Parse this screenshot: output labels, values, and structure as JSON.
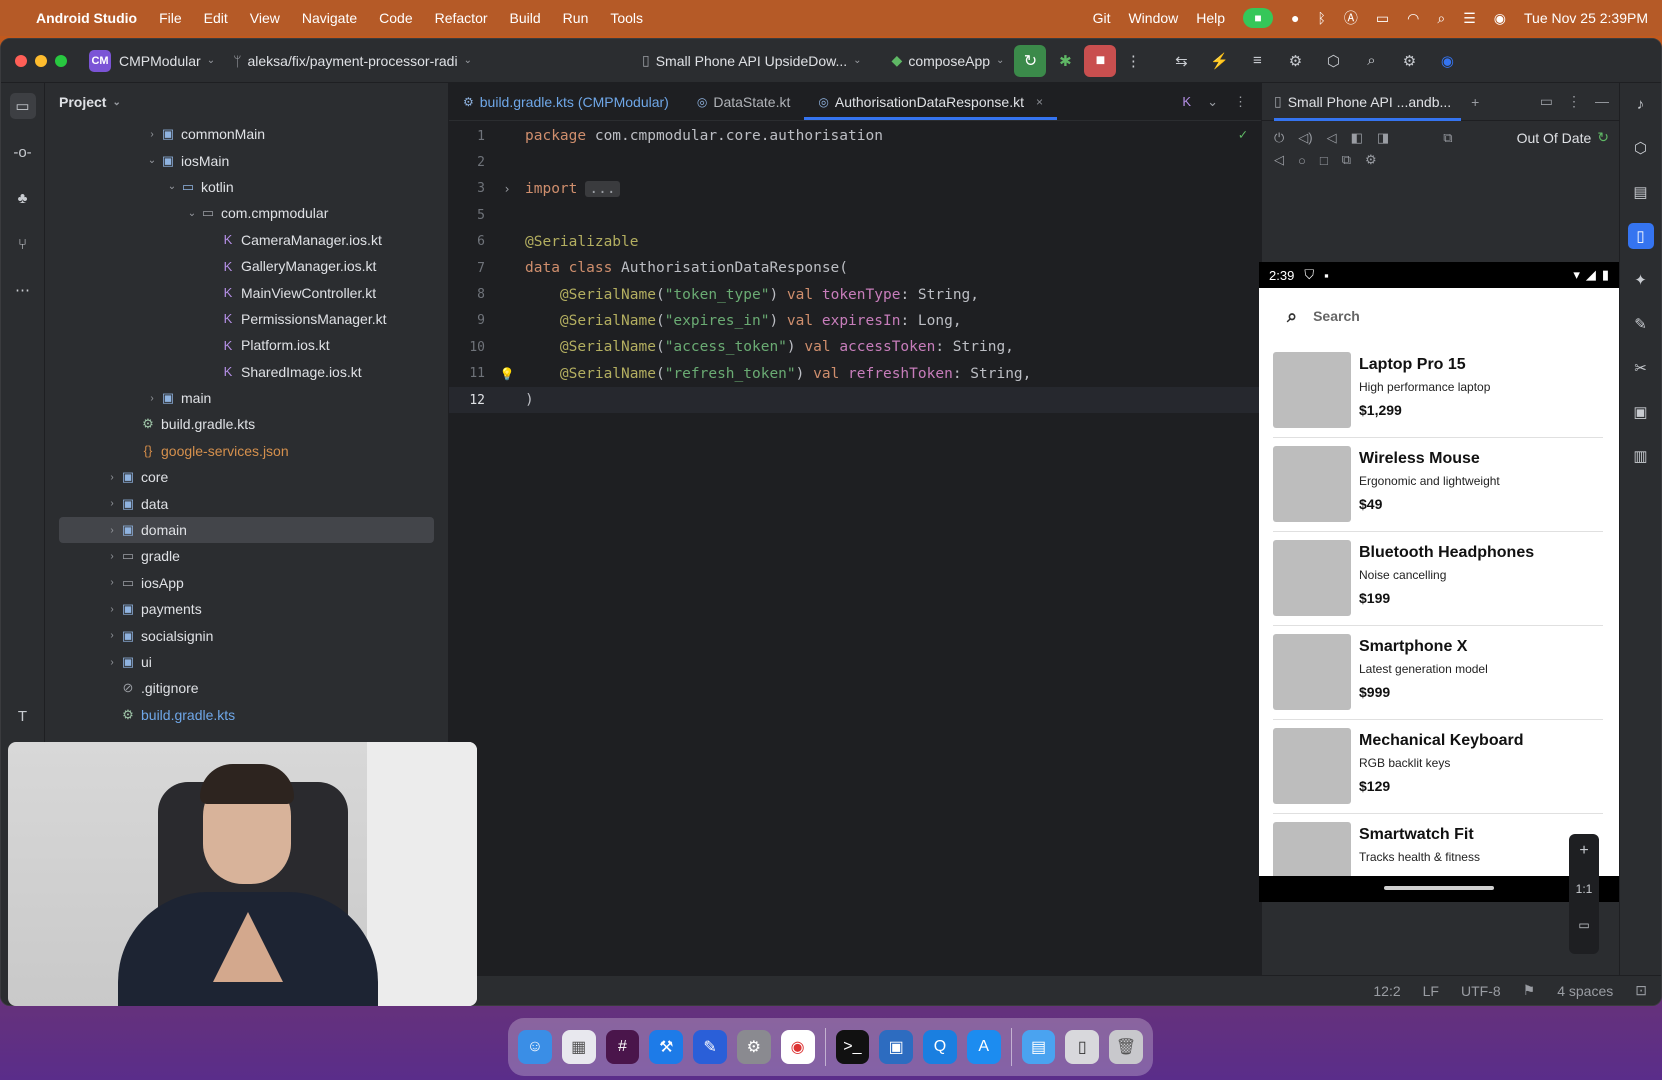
{
  "menubar": {
    "app_name": "Android Studio",
    "items": [
      "File",
      "Edit",
      "View",
      "Navigate",
      "Code",
      "Refactor",
      "Build",
      "Run",
      "Tools"
    ],
    "right_items": [
      "Git",
      "Window",
      "Help"
    ],
    "clock": "Tue Nov 25  2:39PM"
  },
  "titlebar": {
    "project_badge": "CM",
    "project_name": "CMPModular",
    "branch": "aleksa/fix/payment-processor-radi",
    "device": "Small Phone API UpsideDow...",
    "run_config": "composeApp"
  },
  "project_panel": {
    "title": "Project",
    "rows": [
      {
        "indent": 5,
        "arrow": ">",
        "icon": "folder-module-icon",
        "glyph": "▣",
        "cls": "",
        "label": "commonMain",
        "style": ""
      },
      {
        "indent": 5,
        "arrow": "v",
        "icon": "folder-module-icon",
        "glyph": "▣",
        "cls": "",
        "label": "iosMain",
        "style": ""
      },
      {
        "indent": 6,
        "arrow": "v",
        "icon": "folder-source-icon",
        "glyph": "▭",
        "cls": "",
        "label": "kotlin",
        "style": ""
      },
      {
        "indent": 7,
        "arrow": "v",
        "icon": "package-icon",
        "glyph": "▭",
        "cls": "gi",
        "label": "com.cmpmodular",
        "style": ""
      },
      {
        "indent": 8,
        "arrow": "",
        "icon": "kotlin-file-icon",
        "glyph": "K",
        "cls": "kt",
        "label": "CameraManager.ios.kt",
        "style": ""
      },
      {
        "indent": 8,
        "arrow": "",
        "icon": "kotlin-file-icon",
        "glyph": "K",
        "cls": "kt",
        "label": "GalleryManager.ios.kt",
        "style": ""
      },
      {
        "indent": 8,
        "arrow": "",
        "icon": "kotlin-file-icon",
        "glyph": "K",
        "cls": "kt",
        "label": "MainViewController.kt",
        "style": ""
      },
      {
        "indent": 8,
        "arrow": "",
        "icon": "kotlin-file-icon",
        "glyph": "K",
        "cls": "kt",
        "label": "PermissionsManager.kt",
        "style": ""
      },
      {
        "indent": 8,
        "arrow": "",
        "icon": "kotlin-file-icon",
        "glyph": "K",
        "cls": "kt",
        "label": "Platform.ios.kt",
        "style": ""
      },
      {
        "indent": 8,
        "arrow": "",
        "icon": "kotlin-file-icon",
        "glyph": "K",
        "cls": "kt",
        "label": "SharedImage.ios.kt",
        "style": ""
      },
      {
        "indent": 5,
        "arrow": ">",
        "icon": "folder-module-icon",
        "glyph": "▣",
        "cls": "",
        "label": "main",
        "style": ""
      },
      {
        "indent": 4,
        "arrow": "",
        "icon": "gradle-file-icon",
        "glyph": "⚙",
        "cls": "gr",
        "label": "build.gradle.kts",
        "style": ""
      },
      {
        "indent": 4,
        "arrow": "",
        "icon": "json-file-icon",
        "glyph": "{}",
        "cls": "js",
        "label": "google-services.json",
        "style": "orange"
      },
      {
        "indent": 3,
        "arrow": ">",
        "icon": "folder-module-icon",
        "glyph": "▣",
        "cls": "",
        "label": "core",
        "style": ""
      },
      {
        "indent": 3,
        "arrow": ">",
        "icon": "folder-module-icon",
        "glyph": "▣",
        "cls": "",
        "label": "data",
        "style": ""
      },
      {
        "indent": 3,
        "arrow": ">",
        "icon": "folder-module-icon",
        "glyph": "▣",
        "cls": "",
        "label": "domain",
        "style": "selected"
      },
      {
        "indent": 3,
        "arrow": ">",
        "icon": "folder-icon",
        "glyph": "▭",
        "cls": "gi",
        "label": "gradle",
        "style": ""
      },
      {
        "indent": 3,
        "arrow": ">",
        "icon": "folder-icon",
        "glyph": "▭",
        "cls": "gi",
        "label": "iosApp",
        "style": ""
      },
      {
        "indent": 3,
        "arrow": ">",
        "icon": "folder-module-icon",
        "glyph": "▣",
        "cls": "",
        "label": "payments",
        "style": ""
      },
      {
        "indent": 3,
        "arrow": ">",
        "icon": "folder-module-icon",
        "glyph": "▣",
        "cls": "",
        "label": "socialsignin",
        "style": ""
      },
      {
        "indent": 3,
        "arrow": ">",
        "icon": "folder-module-icon",
        "glyph": "▣",
        "cls": "",
        "label": "ui",
        "style": ""
      },
      {
        "indent": 3,
        "arrow": "",
        "icon": "gitignore-icon",
        "glyph": "⊘",
        "cls": "gi",
        "label": ".gitignore",
        "style": ""
      },
      {
        "indent": 3,
        "arrow": "",
        "icon": "gradle-file-icon",
        "glyph": "⚙",
        "cls": "gr",
        "label": "build.gradle.kts",
        "style": "blue"
      }
    ]
  },
  "editor": {
    "tabs": [
      {
        "label": "build.gradle.kts (CMPModular)",
        "active": false
      },
      {
        "label": "DataState.kt",
        "active": false
      },
      {
        "label": "AuthorisationDataResponse.kt",
        "active": true
      }
    ],
    "lines": [
      {
        "n": "1",
        "html": "<span class=\"kw\">package</span> com.cmpmodular.core.authorisation"
      },
      {
        "n": "2",
        "html": ""
      },
      {
        "n": "3",
        "html": "<span class=\"kw\">import</span><span class=\"fold-dots\">...</span>",
        "gutter": ">"
      },
      {
        "n": "5",
        "html": ""
      },
      {
        "n": "6",
        "html": "<span class=\"ann\">@Serializable</span>"
      },
      {
        "n": "7",
        "html": "<span class=\"kw\">data class</span> AuthorisationDataResponse("
      },
      {
        "n": "8",
        "html": "    <span class=\"ann\">@SerialName</span>(<span class=\"str\">\"token_type\"</span>) <span class=\"kw\">val</span> <span class=\"prop\">tokenType</span>: String,"
      },
      {
        "n": "9",
        "html": "    <span class=\"ann\">@SerialName</span>(<span class=\"str\">\"expires_in\"</span>) <span class=\"kw\">val</span> <span class=\"prop\">expiresIn</span>: Long,"
      },
      {
        "n": "10",
        "html": "    <span class=\"ann\">@SerialName</span>(<span class=\"str\">\"access_token\"</span>) <span class=\"kw\">val</span> <span class=\"prop\">accessToken</span>: String,"
      },
      {
        "n": "11",
        "html": "    <span class=\"ann\">@SerialName</span>(<span class=\"str\">\"refresh_token\"</span>) <span class=\"kw\">val</span> <span class=\"prop\">refreshToken</span>: String,",
        "bulb": true
      },
      {
        "n": "12",
        "html": ")",
        "current": true
      }
    ]
  },
  "device_panel": {
    "tab_label": "Small Phone API ...andb...",
    "out_of_date": "Out Of Date",
    "phone": {
      "time": "2:39",
      "search_placeholder": "Search",
      "products": [
        {
          "name": "Laptop Pro 15",
          "desc": "High performance laptop",
          "price": "$1,299"
        },
        {
          "name": "Wireless Mouse",
          "desc": "Ergonomic and lightweight",
          "price": "$49"
        },
        {
          "name": "Bluetooth Headphones",
          "desc": "Noise cancelling",
          "price": "$199"
        },
        {
          "name": "Smartphone X",
          "desc": "Latest generation model",
          "price": "$999"
        },
        {
          "name": "Mechanical Keyboard",
          "desc": "RGB backlit keys",
          "price": "$129"
        },
        {
          "name": "Smartwatch Fit",
          "desc": "Tracks health & fitness",
          "price": ""
        }
      ],
      "zoom_label": "1:1"
    }
  },
  "statusbar": {
    "position": "12:2",
    "line_sep": "LF",
    "encoding": "UTF-8",
    "indent": "4 spaces"
  }
}
